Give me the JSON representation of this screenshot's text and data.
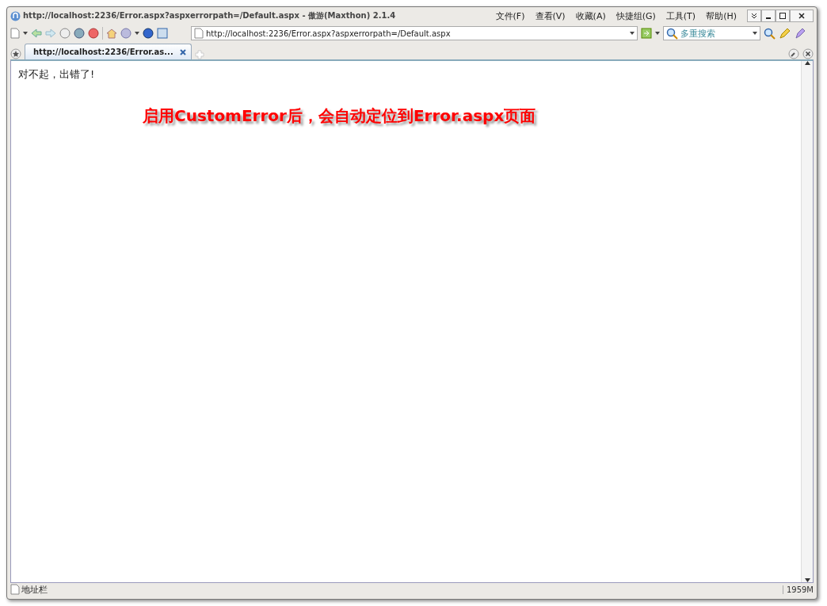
{
  "window": {
    "title": "http://localhost:2236/Error.aspx?aspxerrorpath=/Default.aspx - 傲游(Maxthon) 2.1.4"
  },
  "menu": [
    "文件(F)",
    "查看(V)",
    "收藏(A)",
    "快捷组(G)",
    "工具(T)",
    "帮助(H)"
  ],
  "address": {
    "value": "http://localhost:2236/Error.aspx?aspxerrorpath=/Default.aspx"
  },
  "search": {
    "placeholder": "多重搜索"
  },
  "tabs": [
    {
      "label": "http://localhost:2236/Error.as...",
      "selected": true
    }
  ],
  "page": {
    "message": "对不起，出错了!",
    "annotation": "启用CustomError后，会自动定位到Error.aspx页面"
  },
  "status_bar": {
    "label": "地址栏",
    "memory": "1959M"
  }
}
